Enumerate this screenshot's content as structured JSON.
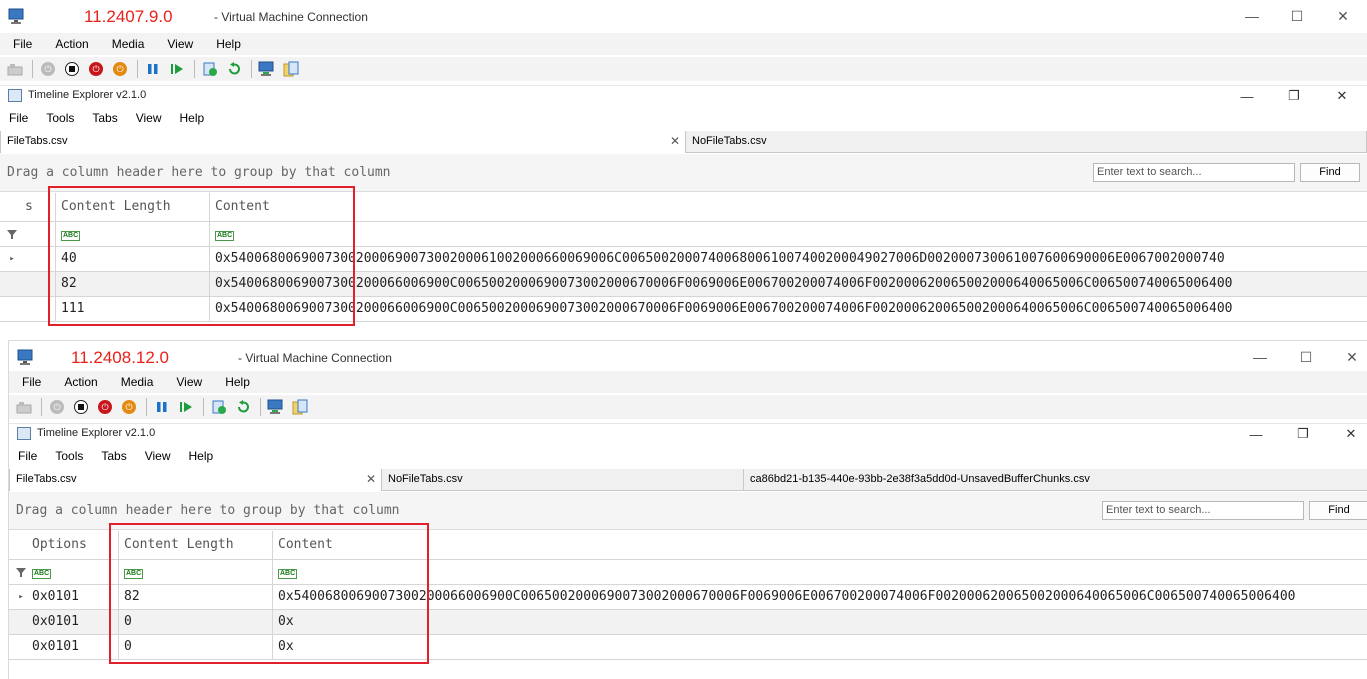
{
  "window1": {
    "version_label": "11.2407.9.0",
    "title": "- Virtual Machine Connection",
    "menu": [
      "File",
      "Action",
      "Media",
      "View",
      "Help"
    ],
    "app": {
      "title": "Timeline Explorer v2.1.0",
      "menu": [
        "File",
        "Tools",
        "Tabs",
        "View",
        "Help"
      ],
      "tabs": [
        "FileTabs.csv",
        "NoFileTabs.csv"
      ],
      "group_hint": "Drag a column header here to group by that column",
      "search_placeholder": "Enter text to search...",
      "find_label": "Find",
      "columns": [
        "s",
        "Content Length",
        "Content"
      ],
      "rows": [
        {
          "length": "40",
          "content": "0x5400680069007300200069007300200061002000660069006C00650020007400680061007400200049027006D002000730061007600690006E0067002000740"
        },
        {
          "length": "82",
          "content": "0x5400680069007300200066006900C0065002000690073002000670006F0069006E006700200074006F002000620065002000640065006C006500740065006400"
        },
        {
          "length": "111",
          "content": "0x5400680069007300200066006900C0065002000690073002000670006F0069006E006700200074006F002000620065002000640065006C006500740065006400"
        }
      ]
    }
  },
  "window2": {
    "version_label": "11.2408.12.0",
    "title": "- Virtual Machine Connection",
    "menu": [
      "File",
      "Action",
      "Media",
      "View",
      "Help"
    ],
    "app": {
      "title": "Timeline Explorer v2.1.0",
      "menu": [
        "File",
        "Tools",
        "Tabs",
        "View",
        "Help"
      ],
      "tabs": [
        "FileTabs.csv",
        "NoFileTabs.csv",
        "ca86bd21-b135-440e-93bb-2e38f3a5dd0d-UnsavedBufferChunks.csv"
      ],
      "group_hint": "Drag a column header here to group by that column",
      "search_placeholder": "Enter text to search...",
      "find_label": "Find",
      "columns": [
        "Options",
        "Content Length",
        "Content"
      ],
      "rows": [
        {
          "options": "0x0101",
          "length": "82",
          "content": "0x5400680069007300200066006900C0065002000690073002000670006F0069006E006700200074006F002000620065002000640065006C006500740065006400"
        },
        {
          "options": "0x0101",
          "length": "0",
          "content": "0x"
        },
        {
          "options": "0x0101",
          "length": "0",
          "content": "0x"
        }
      ]
    }
  },
  "colors": {
    "annotation": "#e0202a",
    "version_text": "#e8211a"
  }
}
